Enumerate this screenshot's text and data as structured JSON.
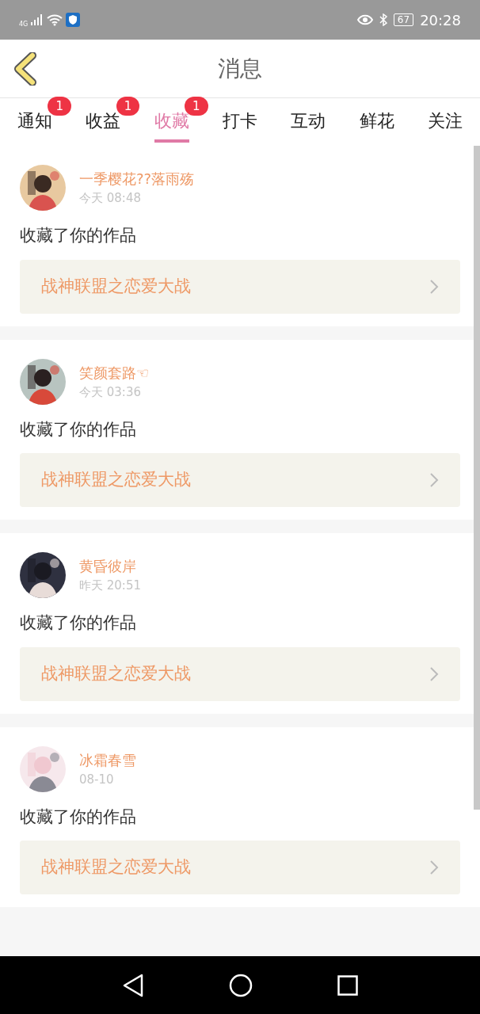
{
  "status_bar": {
    "network": "4G",
    "battery": "67",
    "time": "20:28"
  },
  "header": {
    "title": "消息"
  },
  "tabs": [
    {
      "label": "通知",
      "selected": false,
      "badge": "1"
    },
    {
      "label": "收益",
      "selected": false,
      "badge": "1"
    },
    {
      "label": "收藏",
      "selected": true,
      "badge": "1"
    },
    {
      "label": "打卡",
      "selected": false
    },
    {
      "label": "互动",
      "selected": false
    },
    {
      "label": "鲜花",
      "selected": false
    },
    {
      "label": "关注",
      "selected": false
    }
  ],
  "messages": [
    {
      "user": "一季樱花??落雨殇",
      "time": "今天 08:48",
      "action": "收藏了你的作品",
      "work": "战神联盟之恋爱大战"
    },
    {
      "user": "笑颜套路☜",
      "time": "今天 03:36",
      "action": "收藏了你的作品",
      "work": "战神联盟之恋爱大战"
    },
    {
      "user": "黄昏彼岸",
      "time": "昨天 20:51",
      "action": "收藏了你的作品",
      "work": "战神联盟之恋爱大战"
    },
    {
      "user": "冰霜春雪",
      "time": "08-10",
      "action": "收藏了你的作品",
      "work": "战神联盟之恋爱大战"
    }
  ]
}
